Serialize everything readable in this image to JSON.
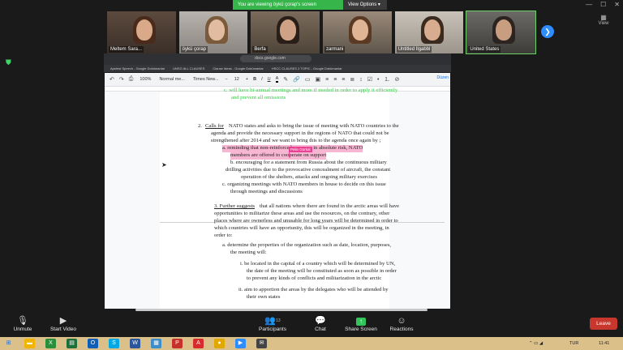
{
  "banner": {
    "sharing_text": "You are viewing öykü çorap's screen",
    "view_options": "View Options ▾"
  },
  "window": {
    "minimize": "—",
    "maximize": "☐",
    "close": "✕"
  },
  "participants": [
    {
      "name": "Meltem Sara..."
    },
    {
      "name": "öykü çorap"
    },
    {
      "name": "Berfa"
    },
    {
      "name": "zarmani"
    },
    {
      "name": "Untitled Ilgabbl"
    },
    {
      "name": "United States"
    }
  ],
  "view_label": "View",
  "browser": {
    "address": "docs.google.com",
    "bookmarks": [
      "Apelest Speech - Google Dokümanlar",
      "UNSG ALL CLAUSES",
      "Clause Ideas - Google Dokümanlar",
      "HSCC CLAUSES 2 TOPIC - Google Dokümanlar"
    ]
  },
  "toolbar": {
    "zoom": "100%",
    "style": "Normal me...",
    "font": "Times New...",
    "size": "12",
    "bold": "B",
    "italic": "I",
    "underline": "U",
    "text_color": "A",
    "edit_mode": "Düzen"
  },
  "doc": {
    "line_c_green": "c.   will have bi-annual meetings and more if needed in order to apply it efficiently",
    "line_c_green2": "and prevent all omissions",
    "clause2_num": "2.",
    "clause2_head": "Calls for",
    "clause2_text1": "NATO states and asks to bring the issue of meeting with NATO countries to the",
    "clause2_text2": "agenda and provide the necessary support in the regions of NATO that could not be",
    "clause2_text3": "strengthened after 2014 and we want to bring this to the agenda once again by ;",
    "item_a1": "a. reminding that non-reinforced areas are in absolute risk, NATO",
    "item_a2": "members are offered to cooperate on support",
    "cursor_user": "Pelin Gürkal",
    "item_b1": "b. encouraging for a statement from Russia about the continuous military",
    "item_b2": "drilling activities due to the provocative concealment of aircraft, the constant",
    "item_b3": "operation of the shelters, attacks and ongoing military exercises",
    "item_c1": "c. organizing meetings with NATO members in house to decide on this issue",
    "item_c2": "through meetings and discussions",
    "clause3_head": "3. Further suggests",
    "clause3_text1": "that all nations where there are found in the arctic areas will have",
    "clause3_text2": "opportunities to militarize these areas and use the resources, on the contrary, other",
    "clause3_text3": "places where are ownerless and unusable for long years will be determined in order to",
    "clause3_text4": "which countries will have an opportunity, this will be organized in the meeting, in",
    "clause3_text5": "order to:",
    "sub_a1": "a.   determine the properties of the organization such as date, location, purposes,",
    "sub_a2": "the meeting will:",
    "sub_i1": "i.   be located in the capital of a country which will be determined by UN,",
    "sub_i2": "the date of the meeting will be constituted as soon as possible in order",
    "sub_i3": "to prevent any kinds of conflicts and militarization in the arctic",
    "sub_ii1": "ii.   aim to apportion the areas by the delegates who will be attended by",
    "sub_ii2": "their own states"
  },
  "controls": {
    "unmute": "Unmute",
    "start_video": "Start Video",
    "participants": "Participants",
    "participant_count": "13",
    "chat": "Chat",
    "share_screen": "Share Screen",
    "reactions": "Reactions",
    "leave": "Leave"
  },
  "taskbar": {
    "language": "TUR",
    "time": "11:41"
  },
  "colors": {
    "zoom_green": "#35b54a",
    "leave_red": "#c8372d",
    "highlight_pink": "#f7b6d2",
    "doc_green": "#2ecc40"
  }
}
